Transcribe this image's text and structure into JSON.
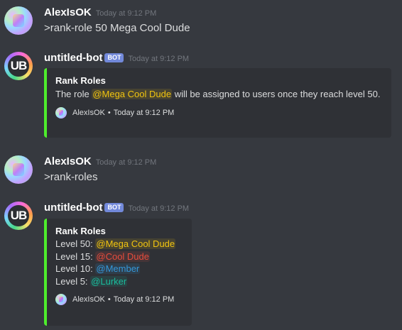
{
  "messages": [
    {
      "author": "AlexIsOK",
      "timestamp": "Today at 9:12 PM",
      "content": ">rank-role 50 Mega Cool Dude"
    },
    {
      "author": "untitled-bot",
      "bot_tag": "BOT",
      "avatar_text": "UB",
      "timestamp": "Today at 9:12 PM",
      "embed": {
        "title": "Rank Roles",
        "desc_prefix": "The role ",
        "mention": "@Mega Cool Dude",
        "desc_suffix": " will be assigned to users once they reach level 50.",
        "footer_author": "AlexIsOK",
        "footer_sep": "•",
        "footer_time": "Today at 9:12 PM",
        "accent_color": "#4eed2c"
      }
    },
    {
      "author": "AlexIsOK",
      "timestamp": "Today at 9:12 PM",
      "content": ">rank-roles"
    },
    {
      "author": "untitled-bot",
      "bot_tag": "BOT",
      "avatar_text": "UB",
      "timestamp": "Today at 9:12 PM",
      "embed": {
        "title": "Rank Roles",
        "lines": [
          {
            "label": "Level 50: ",
            "mention": "@Mega Cool Dude",
            "color": "#f1c40f"
          },
          {
            "label": "Level 15: ",
            "mention": "@Cool Dude",
            "color": "#e74c3c"
          },
          {
            "label": "Level 10: ",
            "mention": "@Member",
            "color": "#3498db"
          },
          {
            "label": "Level 5: ",
            "mention": "@Lurker",
            "color": "#1abc9c"
          }
        ],
        "footer_author": "AlexIsOK",
        "footer_sep": "•",
        "footer_time": "Today at 9:12 PM",
        "accent_color": "#4eed2c"
      }
    }
  ]
}
